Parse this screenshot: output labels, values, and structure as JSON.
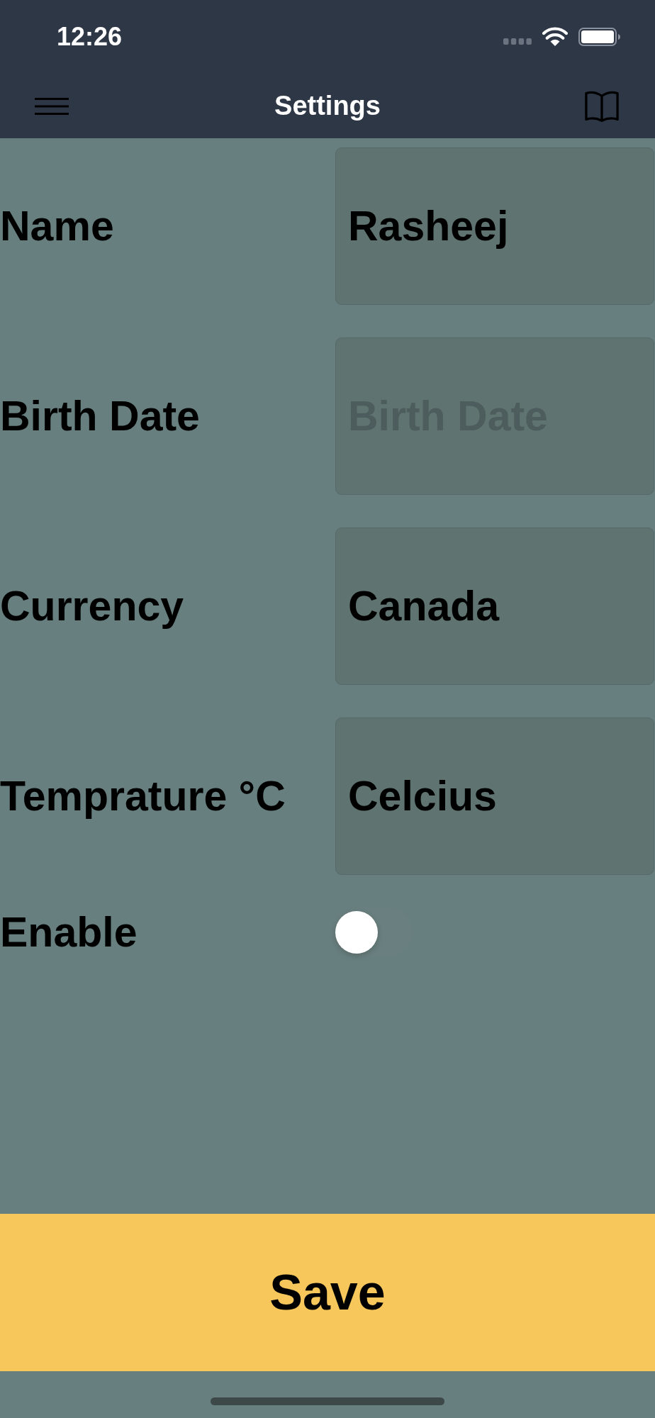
{
  "status_bar": {
    "time": "12:26"
  },
  "nav_bar": {
    "title": "Settings"
  },
  "fields": [
    {
      "label": "Name",
      "value": "Rasheej"
    },
    {
      "label": "Birth Date",
      "placeholder": "Birth Date"
    },
    {
      "label": "Currency",
      "value": "Canada"
    },
    {
      "label": "Temprature °C",
      "value": "Celcius"
    }
  ],
  "enable": {
    "label": "Enable",
    "on": false
  },
  "save_button": {
    "label": "Save"
  }
}
